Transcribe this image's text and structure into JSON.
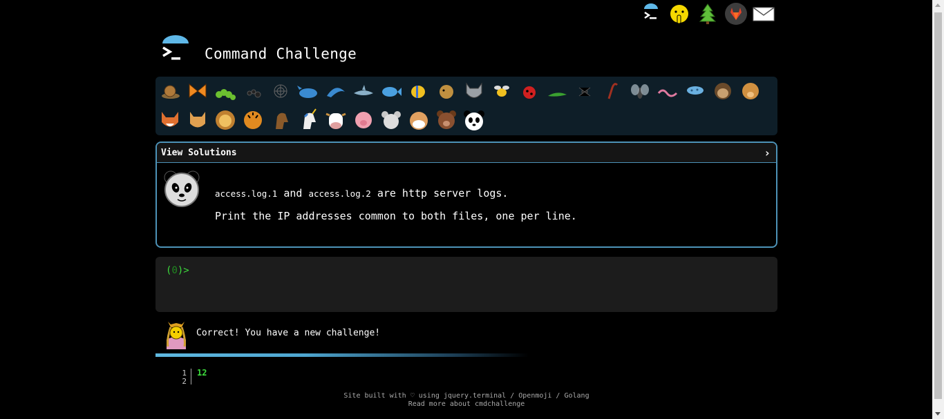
{
  "site": {
    "title": "Command Challenge"
  },
  "top_nav": [
    {
      "name": "terminal-logo-icon"
    },
    {
      "name": "shushing-face-icon"
    },
    {
      "name": "tree-icon"
    },
    {
      "name": "gitlab-icon"
    },
    {
      "name": "envelope-icon"
    }
  ],
  "animals": {
    "row1": [
      "snail",
      "butterfly",
      "caterpillar",
      "ant",
      "spider-web",
      "whale",
      "dolphin",
      "shark",
      "fish",
      "tropical-fish",
      "pufferfish",
      "wolf",
      "bee",
      "ladybug",
      "lizard",
      "spider",
      "scorpion",
      "fly",
      "worm",
      "microbe",
      "monkey",
      "dog"
    ],
    "row2": [
      "fox",
      "cat",
      "lion",
      "tiger",
      "horse",
      "unicorn",
      "cow",
      "pig",
      "mouse",
      "hamster",
      "bear",
      "panda"
    ]
  },
  "challenge": {
    "header_label": "View Solutions",
    "file1": "access.log.1",
    "conj": "and",
    "file2": "access.log.2",
    "desc_rest": "are http server logs.",
    "task": "Print the IP addresses common to both files, one per line."
  },
  "terminal": {
    "prompt_open": "(",
    "prompt_num": "0",
    "prompt_close": ")>"
  },
  "status": {
    "message": "Correct! You have a new challenge!"
  },
  "output": {
    "line_numbers": [
      "1",
      "2"
    ],
    "value": "12"
  },
  "footer": {
    "line1": "Site built with ♡ using jquery.terminal / Openmoji / Golang",
    "line2": "Read more about cmdchallenge"
  },
  "colors": {
    "accent": "#4d93b8",
    "prompt": "#3ddc3d",
    "strip_bg": "#0e1e28",
    "terminal_bg": "#1c1c1c"
  }
}
